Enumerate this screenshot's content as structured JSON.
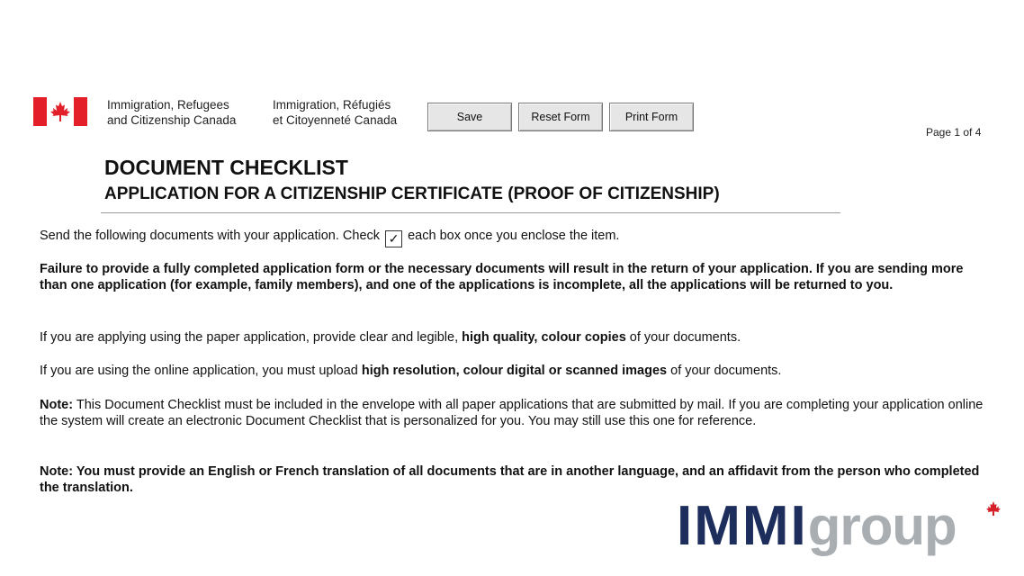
{
  "header": {
    "agency_en_line1": "Immigration, Refugees",
    "agency_en_line2": "and Citizenship Canada",
    "agency_fr_line1": "Immigration, Réfugiés",
    "agency_fr_line2": "et Citoyenneté Canada",
    "flag_colors": {
      "red": "#e3202a",
      "white": "#ffffff"
    }
  },
  "toolbar": {
    "save_label": "Save",
    "reset_label": "Reset Form",
    "print_label": "Print Form"
  },
  "page_indicator": "Page 1 of 4",
  "document": {
    "title": "DOCUMENT CHECKLIST",
    "subtitle": "APPLICATION FOR A CITIZENSHIP CERTIFICATE (PROOF OF CITIZENSHIP)",
    "send_prefix": "Send the following documents with your application.  Check",
    "send_check_glyph": "✓",
    "send_suffix": "each box once you enclose the item.",
    "failure_text": "Failure to provide a fully completed application form or the necessary documents will result in the return of your application. If you are sending more than one application (for example, family members), and one of the applications is incomplete, all the applications will be returned to you.",
    "paper_prefix": "If you are applying using the paper application, provide clear and legible,",
    "paper_bold": "high quality, colour copies",
    "paper_suffix": "of your documents.",
    "online_prefix": "If you are using the online application, you must upload",
    "online_bold": "high resolution, colour digital or scanned images",
    "online_suffix": "of your documents.",
    "note1_label": "Note:",
    "note1_text": "This Document Checklist must be included in the envelope with all paper applications that are submitted by mail. If you are completing your application online the system will create an electronic Document Checklist that is personalized for you. You may still use this one for reference.",
    "note2_text": "Note: You must provide an English or French translation of all documents that are in another language, and an affidavit from the person who completed the translation."
  },
  "watermark": {
    "part1": "IMMI",
    "part2": "group",
    "colors": {
      "navy": "#1d2e5c",
      "gray": "#a9aeb3",
      "leaf": "#d62027"
    }
  }
}
